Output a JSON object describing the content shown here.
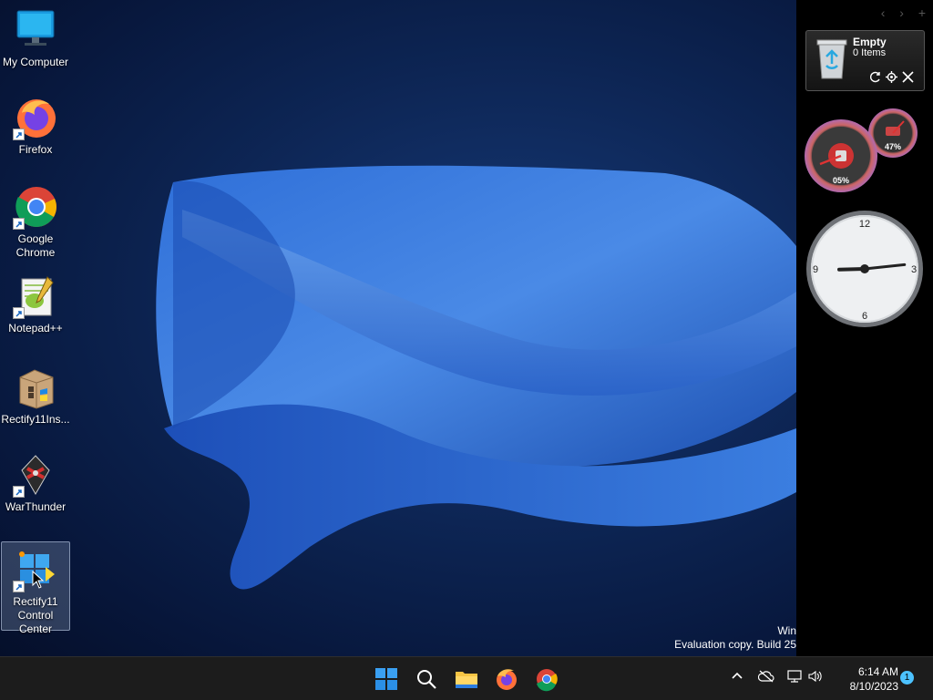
{
  "desktop": {
    "icons": [
      {
        "label": "My Computer",
        "icon": "monitor-icon",
        "shortcut": false
      },
      {
        "label": "Firefox",
        "icon": "firefox-icon",
        "shortcut": true
      },
      {
        "label": "Google Chrome",
        "icon": "chrome-icon",
        "shortcut": true
      },
      {
        "label": "Notepad++",
        "icon": "notepadpp-icon",
        "shortcut": true
      },
      {
        "label": "Rectify11Ins...",
        "icon": "installer-package-icon",
        "shortcut": false
      },
      {
        "label": "WarThunder",
        "icon": "warthunder-icon",
        "shortcut": true
      },
      {
        "label": "Rectify11 Control Center",
        "icon": "rectify11-control-center-icon",
        "shortcut": true,
        "selected": true
      }
    ],
    "watermark_line1": "Win",
    "watermark_line2": "Evaluation copy. Build 25"
  },
  "sidebar": {
    "nav": [
      "‹",
      "›",
      "+"
    ],
    "recycle_bin": {
      "title": "Empty",
      "count": "0 Items"
    },
    "meters": {
      "cpu": "05%",
      "memory": "47%"
    },
    "clock_face": {
      "n12": "12",
      "n3": "3",
      "n6": "6",
      "n9": "9",
      "hour": 2.95,
      "minute": 14
    }
  },
  "taskbar": {
    "apps": [
      "start-icon",
      "search-icon",
      "file-explorer-icon",
      "firefox-icon",
      "chrome-icon"
    ],
    "time": "6:14 AM",
    "date": "8/10/2023",
    "notifications": "1"
  },
  "colors": {
    "accent": "#4cc2ff",
    "taskbar": "#1c1c1c",
    "sidebar": "#000000"
  }
}
